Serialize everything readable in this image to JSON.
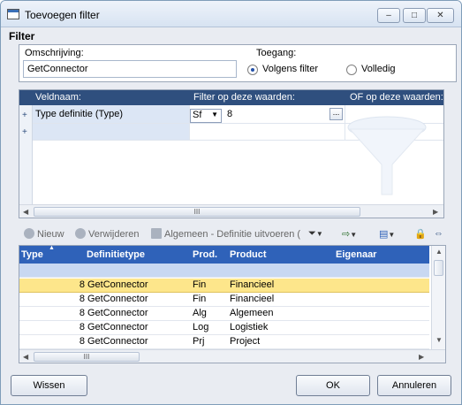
{
  "window": {
    "title": "Toevoegen filter"
  },
  "filter": {
    "section_label": "Filter",
    "omschrijving_label": "Omschrijving:",
    "omschrijving_value": "GetConnector",
    "toegang_label": "Toegang:",
    "option_volgens": "Volgens filter",
    "option_volledig": "Volledig",
    "selected_option": "Volgens filter"
  },
  "criteria_grid": {
    "columns": [
      "Veldnaam:",
      "Filter op deze waarden:",
      "OF op deze waarden:"
    ],
    "rows": [
      {
        "field": "Type definitie (Type)",
        "operator": "Sf",
        "value": "8"
      }
    ]
  },
  "toolbar": {
    "new_label": "Nieuw",
    "delete_label": "Verwijderen",
    "general_label": "Algemeen - Definitie uitvoeren ("
  },
  "results_grid": {
    "columns": [
      "Type",
      "Definitietype",
      "Prod.",
      "Product",
      "Eigenaar"
    ],
    "rows": [
      {
        "type": "8",
        "definitietype": "GetConnector",
        "prod": "Fin",
        "product": "Financieel",
        "eigenaar": "",
        "selected": true
      },
      {
        "type": "8",
        "definitietype": "GetConnector",
        "prod": "Fin",
        "product": "Financieel",
        "eigenaar": "",
        "selected": false
      },
      {
        "type": "8",
        "definitietype": "GetConnector",
        "prod": "Alg",
        "product": "Algemeen",
        "eigenaar": "",
        "selected": false
      },
      {
        "type": "8",
        "definitietype": "GetConnector",
        "prod": "Log",
        "product": "Logistiek",
        "eigenaar": "",
        "selected": false
      },
      {
        "type": "8",
        "definitietype": "GetConnector",
        "prod": "Prj",
        "product": "Project",
        "eigenaar": "",
        "selected": false
      }
    ]
  },
  "buttons": {
    "clear": "Wissen",
    "ok": "OK",
    "cancel": "Annuleren"
  },
  "colors": {
    "header_dark": "#2f4f7e",
    "header_blue": "#2f62b9",
    "selected_row": "#fde68b"
  }
}
